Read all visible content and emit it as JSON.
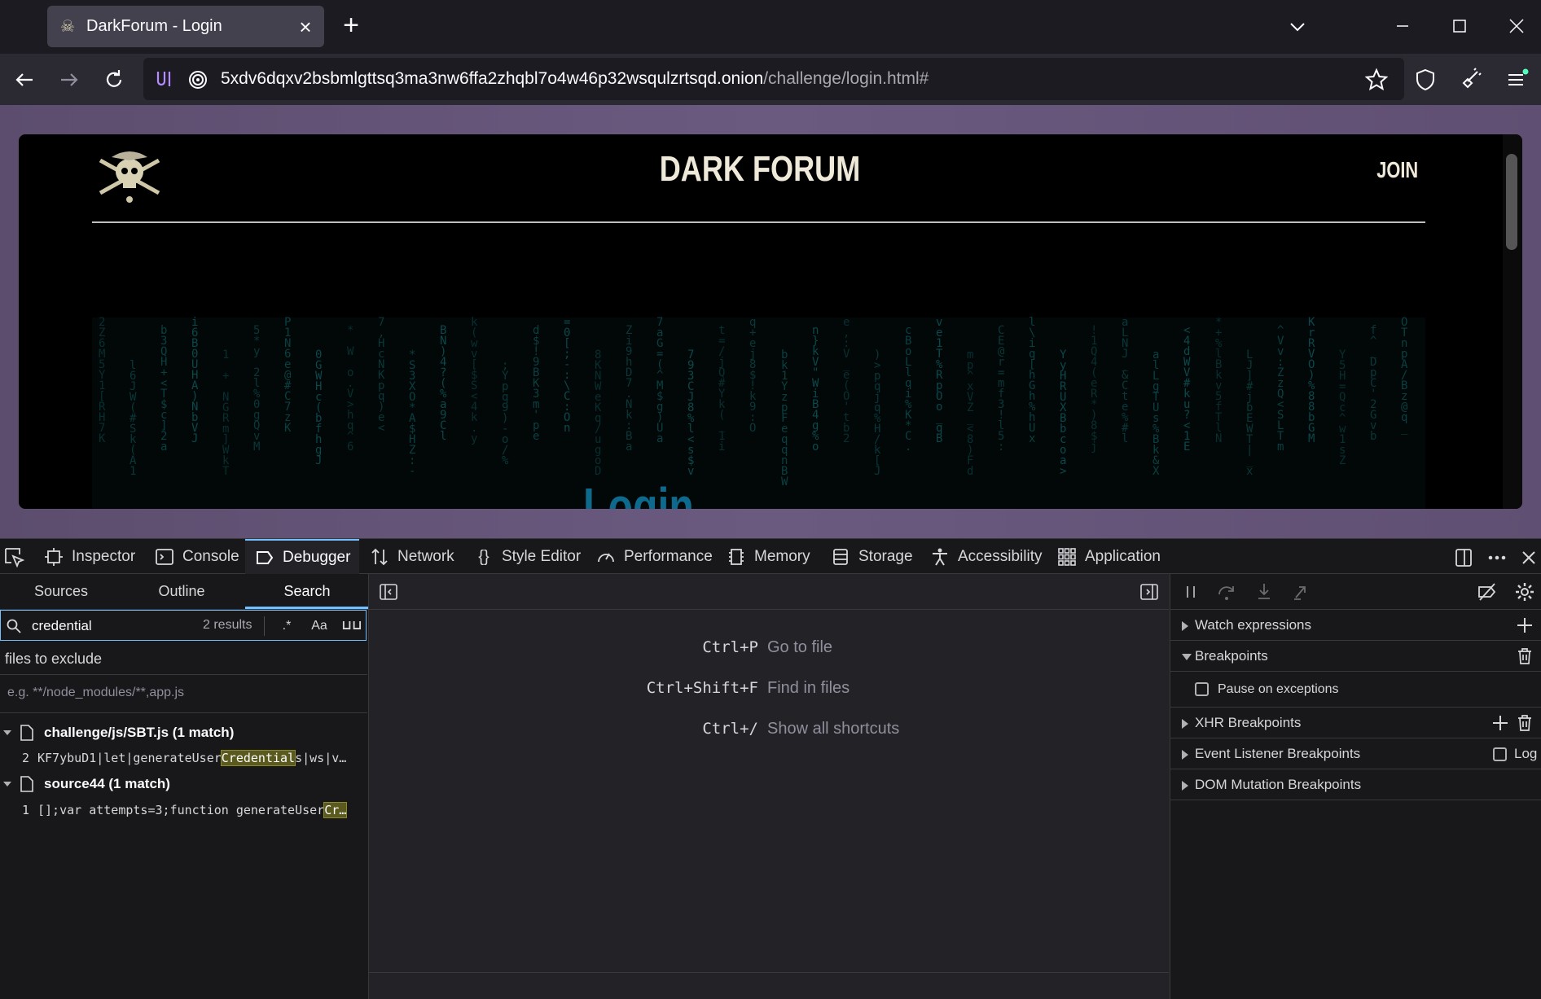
{
  "browser": {
    "tab": {
      "title": "DarkForum - Login",
      "close": "×"
    },
    "new_tab": "+",
    "url": {
      "host": "5xdv6dqxv2bsbmlgttsq3ma3nw6ffa2zhqbl7o4w46p32wsqulzrtsqd.onion",
      "path": "/challenge/login.html#"
    }
  },
  "site": {
    "title": "DARK FORUM",
    "join_label": "JOIN",
    "login_heading": "Login",
    "matrix_columns": [
      "2Z6M5Y1[RH7K",
      " l6JW(#Sk(A1",
      "b3QH+<T$c]2a",
      "i6B0UHA)NbVJ",
      "1 + NGRm]WkT",
      "5*y 2l%0gQvM",
      "P1N6e@#C7zK",
      "0GWHc(bfhgJ",
      "* W o.V>hq^6",
      "7,HcNKpq)e<",
      "*S3XO*A$HZ:-",
      "BN)4?(%a9Cl",
      "k(wv[$S<4k.y",
      " ;Ypq9)-o/%",
      "d$!9BK3m'pe",
      "=0[;-:\\C:On",
      "8KNWeKq/ugoD",
      "Zi9hD7.Nk:Ba",
      "7aG=(^M$g)Ua",
      "793CJ8%l<s$v",
      "t=/jQ#Yk(_1i",
      "q+ej8$!k9:O",
      "bk1YzpFeqqnBW",
      "n}kV\"WiB4g%o",
      "e,:V_e(O'tb2",
      ")>pqjq%H/k[J",
      "cBoLlqi%K*C.",
      "ve1T%RpOo_qB",
      "mp^xVZ_<8)Fd",
      "CE@r=mf3!l5:",
      "l\\iq[hGh%hUx",
      "YyHRUXBbcoa>",
      "!1Q4(eR*)8$j",
      "aLNJ_&Cte%#l",
      "alLgTUs%Bk&X",
      "<4dWV#ku?<1E",
      "*+%lBkv5fTlN",
      "LJ]#jbEWT|_x",
      "^Vv:ZzQ<SLTm",
      "KrRVO)%88bGM",
      "Y5H=Qc^w1sZ",
      "f^_DpC'2Gvb",
      "OTnpA/Bz@q_"
    ]
  },
  "devtools": {
    "tabs": [
      "Inspector",
      "Console",
      "Debugger",
      "Network",
      "Style Editor",
      "Performance",
      "Memory",
      "Storage",
      "Accessibility",
      "Application"
    ],
    "active_tab": "Debugger",
    "left_tabs": [
      "Sources",
      "Outline",
      "Search"
    ],
    "search": {
      "query": "credential",
      "results_count": "2 results",
      "regex_label": ".*",
      "case_label": "Aa",
      "whole_word_label": "⊔⊔",
      "exclude_label": "files to exclude",
      "exclude_placeholder": "e.g. **/node_modules/**,app.js"
    },
    "results": [
      {
        "file": "challenge/js/SBT.js (1 match)",
        "line": "2",
        "pre": "KF7ybuD1|let|generateUser",
        "match": "Credential",
        "post": "s|ws|v…"
      },
      {
        "file": "source44 (1 match)",
        "line": "1",
        "pre": "[];var attempts=3;function generateUser",
        "match": "Cr…",
        "post": ""
      }
    ],
    "shortcuts": [
      {
        "key": "Ctrl+P",
        "label": "Go to file"
      },
      {
        "key": "Ctrl+Shift+F",
        "label": "Find in files"
      },
      {
        "key": "Ctrl+/",
        "label": "Show all shortcuts"
      }
    ],
    "right_panel": {
      "watch": "Watch expressions",
      "breakpoints": "Breakpoints",
      "pause_exceptions": "Pause on exceptions",
      "xhr": "XHR Breakpoints",
      "event_listener": "Event Listener Breakpoints",
      "log": "Log",
      "dom_mutation": "DOM Mutation Breakpoints"
    }
  },
  "colors": {
    "accent": "#75bfff",
    "matrix": "#0d4e52",
    "login": "#0e6a8c",
    "highlight": "#5a5a1e"
  }
}
